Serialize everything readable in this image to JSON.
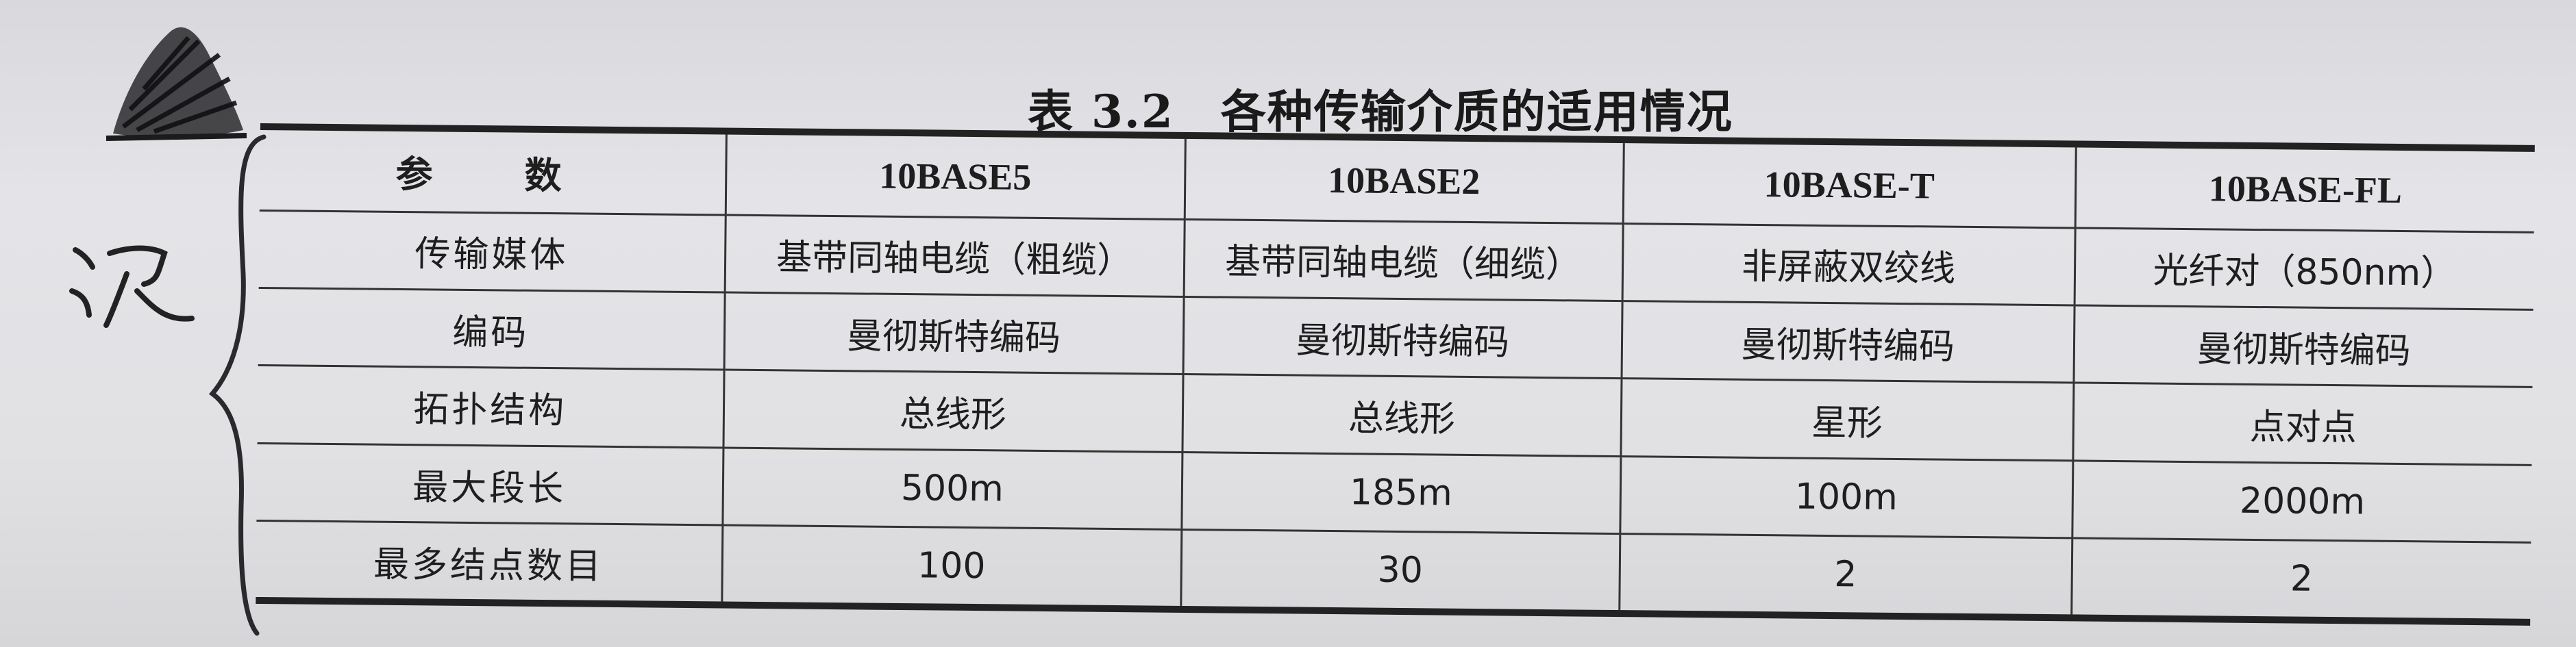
{
  "table_caption": "表 3.2　各种传输介质的适用情况",
  "columns": [
    "参　数",
    "10BASE5",
    "10BASE2",
    "10BASE-T",
    "10BASE-FL"
  ],
  "rows": [
    [
      "传输媒体",
      "基带同轴电缆（粗缆）",
      "基带同轴电缆（细缆）",
      "非屏蔽双绞线",
      "光纤对（850nm）"
    ],
    [
      "编码",
      "曼彻斯特编码",
      "曼彻斯特编码",
      "曼彻斯特编码",
      "曼彻斯特编码"
    ],
    [
      "拓扑结构",
      "总线形",
      "总线形",
      "星形",
      "点对点"
    ],
    [
      "最大段长",
      "500m",
      "185m",
      "100m",
      "2000m"
    ],
    [
      "最多结点数目",
      "100",
      "30",
      "2",
      "2"
    ]
  ],
  "handwriting": {
    "side_character": "况"
  },
  "colors": {
    "paper": "#e1e1e4",
    "ink": "#1e1e1e",
    "rule": "#222222"
  }
}
